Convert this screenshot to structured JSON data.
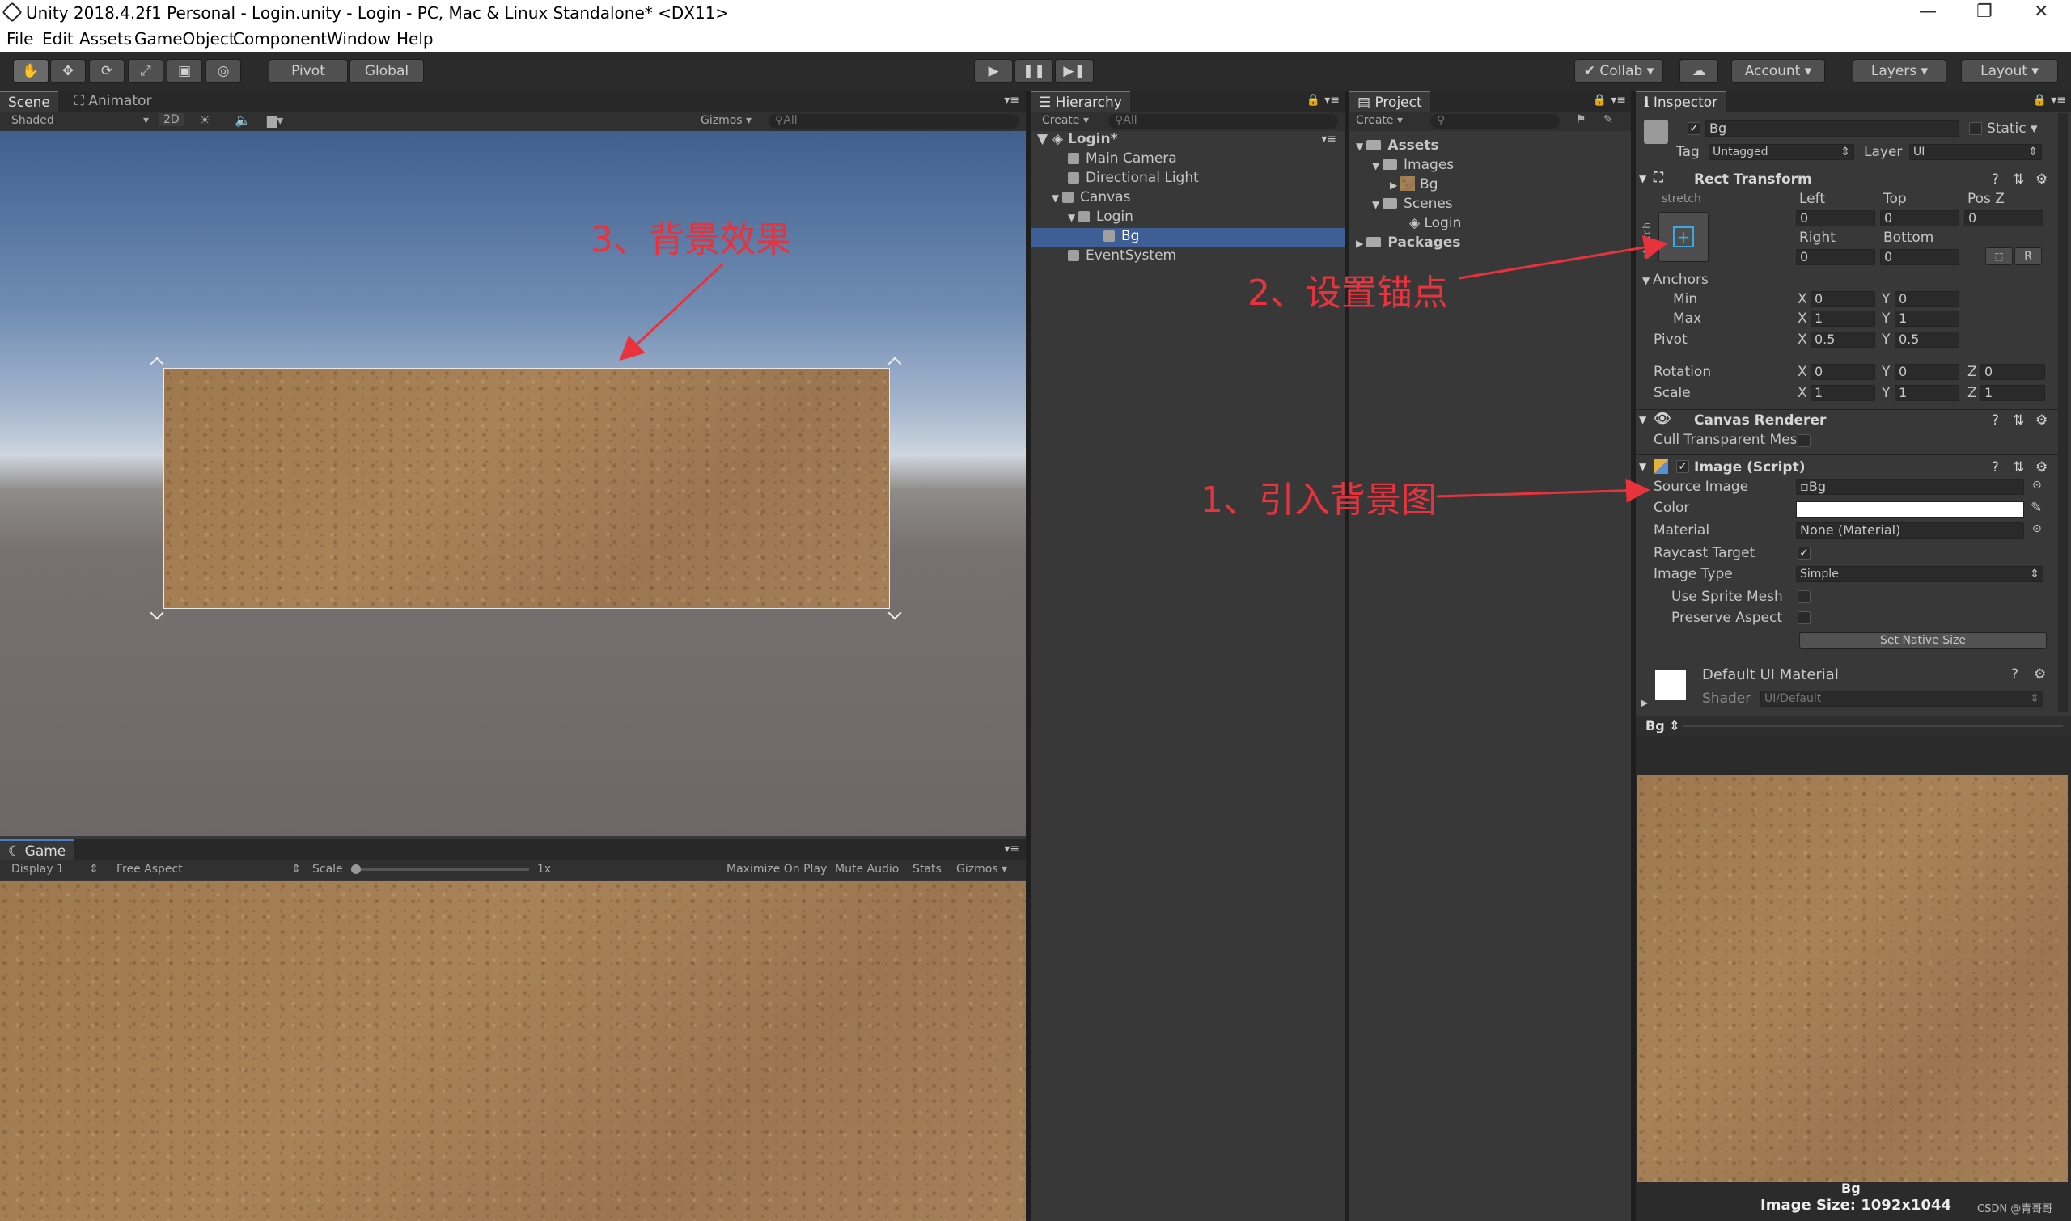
{
  "window": {
    "title": "Unity 2018.4.2f1 Personal - Login.unity - Login - PC, Mac & Linux Standalone* <DX11>",
    "minimize": "—",
    "restore": "❐",
    "close": "✕"
  },
  "menu": [
    "File",
    "Edit",
    "Assets",
    "GameObject",
    "Component",
    "Window",
    "Help"
  ],
  "toolbar": {
    "pivot": "Pivot",
    "global": "Global",
    "collab": "Collab",
    "account": "Account",
    "layers": "Layers",
    "layout": "Layout"
  },
  "scene": {
    "tabs": [
      "Scene",
      "Animator"
    ],
    "shading": "Shaded",
    "mode_2d": "2D",
    "gizmos": "Gizmos",
    "search_placeholder": "All"
  },
  "game": {
    "tab": "Game",
    "display": "Display 1",
    "aspect": "Free Aspect",
    "scale_label": "Scale",
    "scale_value": "1x",
    "maximize": "Maximize On Play",
    "mute": "Mute Audio",
    "stats": "Stats",
    "gizmos": "Gizmos"
  },
  "hierarchy": {
    "tab": "Hierarchy",
    "create": "Create",
    "search_placeholder": "All",
    "scene": "Login*",
    "items": [
      "Main Camera",
      "Directional Light",
      "Canvas",
      "Login",
      "Bg",
      "EventSystem"
    ]
  },
  "project": {
    "tab": "Project",
    "create": "Create",
    "items": [
      "Assets",
      "Images",
      "Bg",
      "Scenes",
      "Login",
      "Packages"
    ]
  },
  "inspector": {
    "tab": "Inspector",
    "object_name": "Bg",
    "static": "Static",
    "tag_label": "Tag",
    "tag_value": "Untagged",
    "layer_label": "Layer",
    "layer_value": "UI",
    "rect_transform": {
      "title": "Rect Transform",
      "stretch_h": "stretch",
      "stretch_v": "stretch",
      "left_label": "Left",
      "left": "0",
      "top_label": "Top",
      "top": "0",
      "posz_label": "Pos Z",
      "posz": "0",
      "right_label": "Right",
      "right": "0",
      "bottom_label": "Bottom",
      "bottom": "0",
      "r_button": "R",
      "anchors": "Anchors",
      "min_label": "Min",
      "min_x": "0",
      "min_y": "0",
      "max_label": "Max",
      "max_x": "1",
      "max_y": "1",
      "pivot_label": "Pivot",
      "pivot_x": "0.5",
      "pivot_y": "0.5",
      "rotation_label": "Rotation",
      "rot_x": "0",
      "rot_y": "0",
      "rot_z": "0",
      "scale_label": "Scale",
      "scale_x": "1",
      "scale_y": "1",
      "scale_z": "1",
      "x": "X",
      "y": "Y",
      "z": "Z"
    },
    "canvas_renderer": {
      "title": "Canvas Renderer",
      "cull": "Cull Transparent Mes"
    },
    "image": {
      "title": "Image (Script)",
      "source_label": "Source Image",
      "source": "Bg",
      "color_label": "Color",
      "material_label": "Material",
      "material": "None (Material)",
      "raycast_label": "Raycast Target",
      "type_label": "Image Type",
      "type": "Simple",
      "sprite_mesh_label": "Use Sprite Mesh",
      "preserve_label": "Preserve Aspect",
      "native_size": "Set Native Size"
    },
    "material": {
      "title": "Default UI Material",
      "shader_label": "Shader",
      "shader": "UI/Default"
    },
    "preview": {
      "header": "Bg",
      "name": "Bg",
      "size": "Image Size: 1092x1044"
    }
  },
  "annotations": {
    "a1": "1、引入背景图",
    "a2": "2、设置锚点",
    "a3": "3、背景效果"
  },
  "watermark": "CSDN @青哥哥"
}
